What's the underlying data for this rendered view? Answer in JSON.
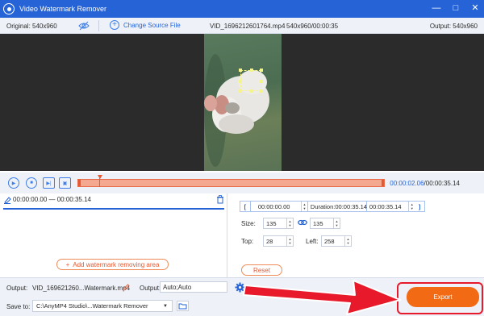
{
  "window": {
    "title": "Video Watermark Remover",
    "controls": [
      "—",
      "□",
      "✕"
    ]
  },
  "info_bar": {
    "original": "Original: 540x960",
    "change_source": "Change Source File",
    "file_name": "VID_1696212601764.mp4",
    "file_res_time": "540x960/00:00:35",
    "output": "Output: 540x960"
  },
  "playback": {
    "current_time": "00:00:02.06",
    "total_time": "/00:00:35.14",
    "progress_fraction": 0.06
  },
  "segment": {
    "time_range": "00:00:00.00 — 00:00:35.14"
  },
  "add_area_button": "Add watermark removing area",
  "trim": {
    "start": "00:00:00.00",
    "duration": "Duration:00:00:35.14",
    "end": "00:00:35.14"
  },
  "props": {
    "size_label": "Size:",
    "width": "135",
    "height": "135",
    "top_label": "Top:",
    "top": "28",
    "left_label": "Left:",
    "left": "258",
    "reset_label": "Reset"
  },
  "bottom": {
    "output_label": "Output:",
    "output_file": "VID_169621260...Watermark.mp4",
    "output2_label": "Output:",
    "output_format": "Auto;Auto",
    "save_label": "Save to:",
    "save_path": "C:\\AnyMP4 Studio\\...Watermark Remover",
    "export_label": "Export"
  },
  "colors": {
    "titlebar": "#2563d6",
    "accent_orange": "#f26a14",
    "highlight_red": "#e8192a"
  }
}
